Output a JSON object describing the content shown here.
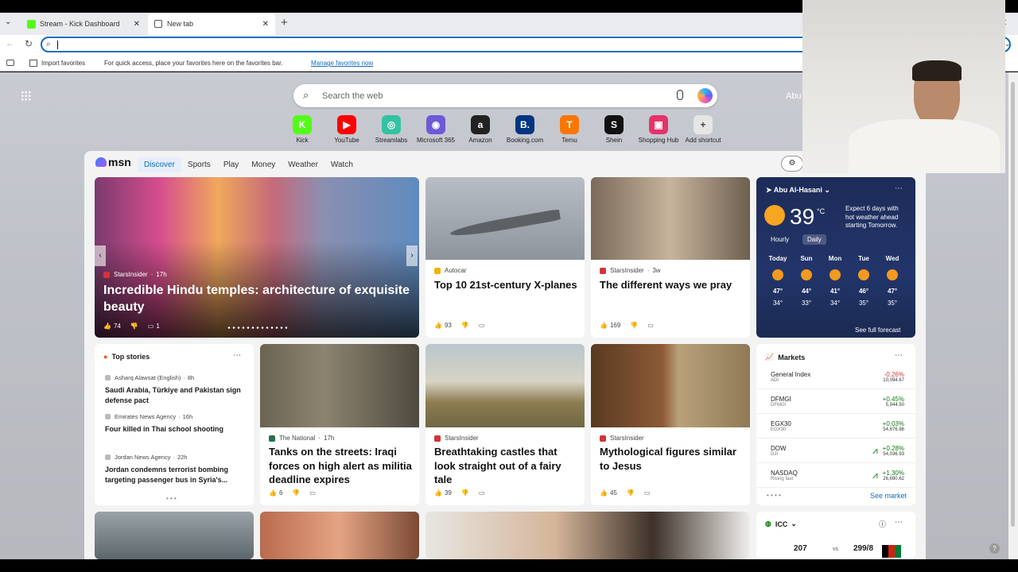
{
  "browser": {
    "tabs": [
      {
        "label": "Stream - Kick Dashboard"
      },
      {
        "label": "New tab"
      }
    ],
    "new_tab": "+",
    "favbar": {
      "import": "Import favorites",
      "message": "For quick access, place your favorites here on the favorites bar.",
      "manage": "Manage favorites now"
    }
  },
  "search": {
    "placeholder": "Search the web"
  },
  "user": {
    "name": "Abu"
  },
  "shortcuts": [
    {
      "label": "Kick",
      "glyph": "K",
      "color": "#53fc18"
    },
    {
      "label": "YouTube",
      "glyph": "▶",
      "color": "#ff0000"
    },
    {
      "label": "Streamlabs",
      "glyph": "◎",
      "color": "#31c3a2"
    },
    {
      "label": "Microsoft 365",
      "glyph": "◉",
      "color": "#6e59d6"
    },
    {
      "label": "Amazon",
      "glyph": "a",
      "color": "#222222"
    },
    {
      "label": "Booking.com",
      "glyph": "B.",
      "color": "#003580"
    },
    {
      "label": "Temu",
      "glyph": "T",
      "color": "#fb7701"
    },
    {
      "label": "Shein",
      "glyph": "S",
      "color": "#111111"
    },
    {
      "label": "Shopping Hub",
      "glyph": "▣",
      "color": "#e3336b"
    },
    {
      "label": "Add shortcut",
      "glyph": "+",
      "color": "#e6e6e6"
    }
  ],
  "msn": {
    "logo": "msn",
    "nav": [
      "Discover",
      "Sports",
      "Play",
      "Money",
      "Weather",
      "Watch"
    ]
  },
  "hero": {
    "source": "StarsInsider",
    "time": "17h",
    "title": "Incredible Hindu temples: architecture of exquisite beauty",
    "likes": "74",
    "comments": "1"
  },
  "card1": {
    "source": "Autocar",
    "title": "Top 10 21st-century X-planes",
    "likes": "93"
  },
  "card2": {
    "source": "StarsInsider",
    "time": "3w",
    "title": "The different ways we pray",
    "likes": "169"
  },
  "weather": {
    "location": "Abu Al-Hasani",
    "temp": "39",
    "unit": "°C",
    "alert": "Expect 6 days with hot weather ahead starting Tomorrow.",
    "tabs": [
      "Hourly",
      "Daily"
    ],
    "days": [
      {
        "d": "Today",
        "hi": "47°",
        "lo": "34°"
      },
      {
        "d": "Sun",
        "hi": "44°",
        "lo": "33°"
      },
      {
        "d": "Mon",
        "hi": "41°",
        "lo": "34°"
      },
      {
        "d": "Tue",
        "hi": "46°",
        "lo": "35°"
      },
      {
        "d": "Wed",
        "hi": "47°",
        "lo": "35°"
      }
    ],
    "forecast": "See full forecast"
  },
  "top_stories": {
    "title": "Top stories",
    "items": [
      {
        "source": "Asharq Alawsat (English)",
        "time": "8h",
        "title": "Saudi Arabia, Türkiye and Pakistan sign defense pact"
      },
      {
        "source": "Emirates News Agency",
        "time": "16h",
        "title": "Four killed in Thai school shooting"
      },
      {
        "source": "Jordan News Agency",
        "time": "22h",
        "title": "Jordan condemns terrorist bombing targeting passenger bus in Syria's..."
      }
    ]
  },
  "card3": {
    "source": "The National",
    "time": "17h",
    "title": "Tanks on the streets: Iraqi forces on high alert as militia deadline expires",
    "likes": "6"
  },
  "card4": {
    "source": "StarsInsider",
    "title": "Breathtaking castles that look straight out of a fairy tale",
    "likes": "39"
  },
  "card5": {
    "source": "StarsInsider",
    "title": "Mythological figures similar to Jesus",
    "likes": "45"
  },
  "markets": {
    "title": "Markets",
    "rows": [
      {
        "name": "General Index",
        "sym": "ADI",
        "chg": "-0.26%",
        "val": "10,094.67",
        "dir": "down"
      },
      {
        "name": "DFMGI",
        "sym": "DFMGI",
        "chg": "+0.45%",
        "val": "5,944.50",
        "dir": "up"
      },
      {
        "name": "EGX30",
        "sym": "EGX30",
        "chg": "+0.03%",
        "val": "54,676.86",
        "dir": "up"
      },
      {
        "name": "DOW",
        "sym": "DJI",
        "chg": "+0.28%",
        "val": "54,036.93",
        "dir": "up"
      },
      {
        "name": "NASDAQ",
        "sym": "Rising fast",
        "chg": "+1.30%",
        "val": "26,690.62",
        "dir": "up"
      }
    ],
    "see": "See market"
  },
  "icc": {
    "title": "ICC",
    "score1": "207",
    "vs": "vs",
    "score2": "299/8"
  },
  "colors": {
    "accent": "#0f6cbd",
    "up": "#107c10",
    "down": "#d13438"
  }
}
